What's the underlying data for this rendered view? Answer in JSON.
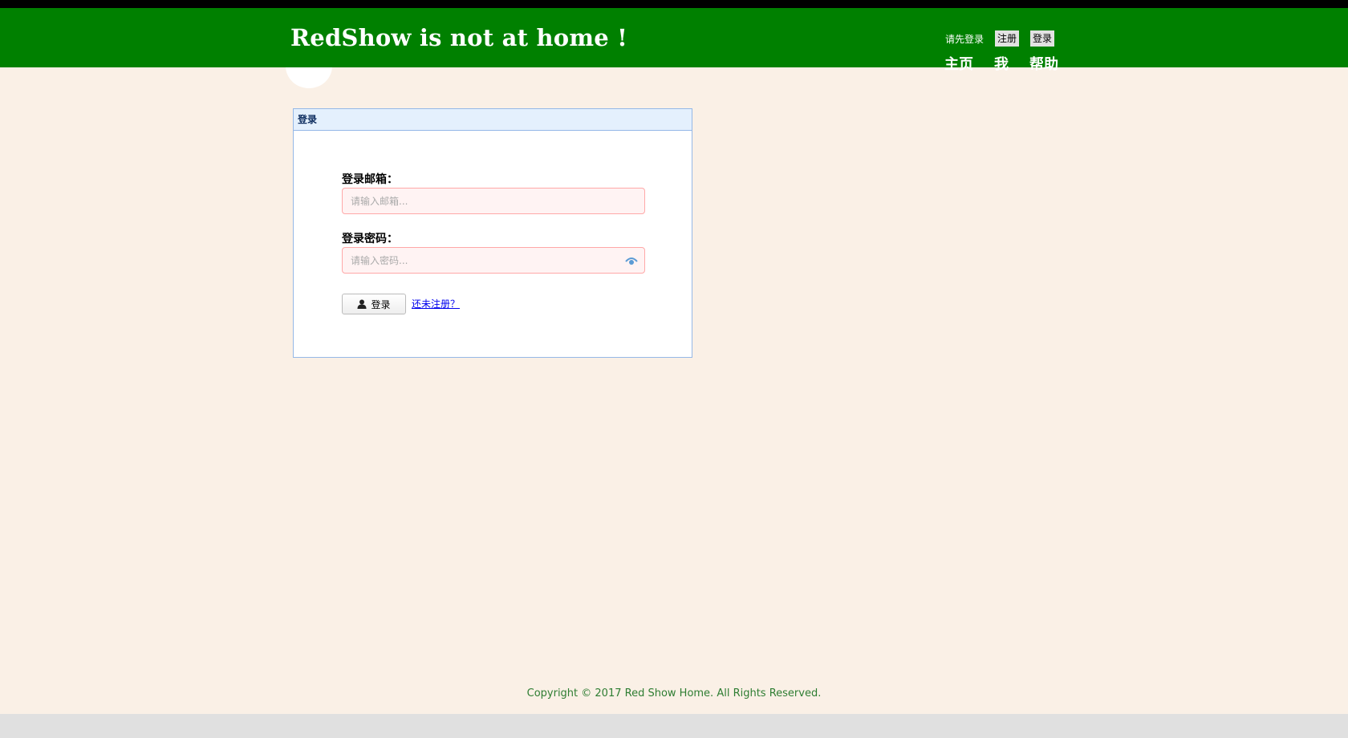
{
  "header": {
    "site_title": "RedShow is not at home !",
    "auth": {
      "hint": "请先登录",
      "register_label": "注册",
      "login_label": "登录"
    },
    "nav": [
      {
        "label": "主页"
      },
      {
        "label": "我"
      },
      {
        "label": "帮助"
      }
    ]
  },
  "login_panel": {
    "title": "登录",
    "email": {
      "label": "登录邮箱：",
      "placeholder": "请输入邮箱..."
    },
    "password": {
      "label": "登录密码：",
      "placeholder": "请输入密码..."
    },
    "submit_label": "登录",
    "register_link": "还未注册？"
  },
  "footer": {
    "copyright": "Copyright © 2017 Red Show Home. All Rights Reserved."
  },
  "icons": {
    "password_toggle": "eye-icon",
    "submit": "user-icon"
  },
  "colors": {
    "header_bg": "#008000",
    "page_bg": "#faf0e6",
    "input_bg": "#fff3f3",
    "input_border": "#ffa8a8",
    "panel_border": "#95b8e7",
    "footer_text": "#2e7d32"
  }
}
